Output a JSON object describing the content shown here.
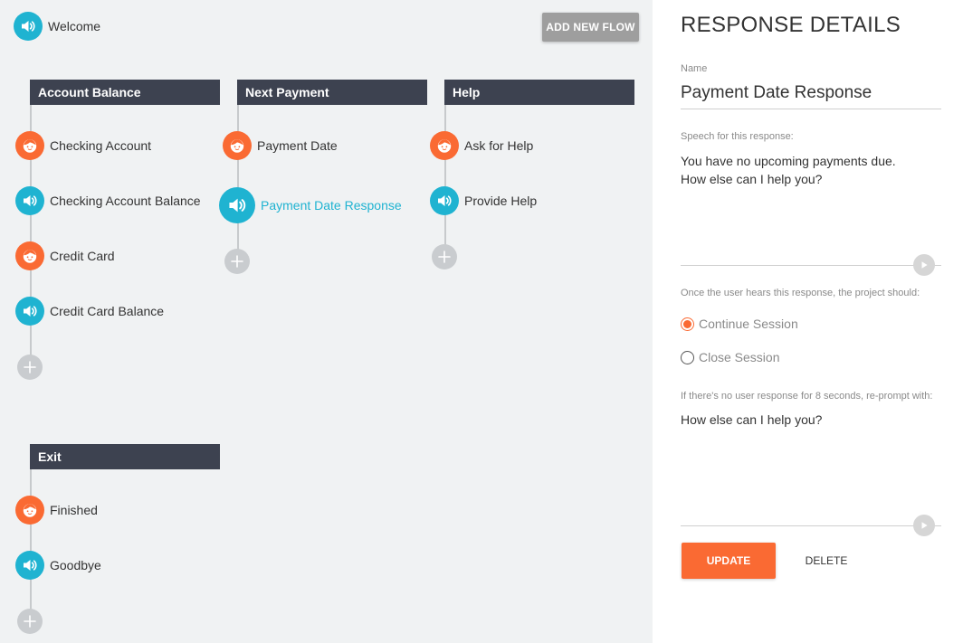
{
  "colors": {
    "accent_teal": "#1fb3d1",
    "accent_orange": "#fa6a33",
    "header_dark": "#3d4250",
    "canvas_bg": "#f0f2f3"
  },
  "welcome": {
    "label": "Welcome",
    "icon": "speaker-icon"
  },
  "toolbar": {
    "add_flow_label": "ADD NEW FLOW"
  },
  "flows": [
    {
      "title": "Account Balance",
      "nodes": [
        {
          "label": "Checking Account",
          "type": "user-input",
          "icon": "face-icon"
        },
        {
          "label": "Checking Account Balance",
          "type": "response",
          "icon": "speaker-icon"
        },
        {
          "label": "Credit Card",
          "type": "user-input",
          "icon": "face-icon"
        },
        {
          "label": "Credit Card Balance",
          "type": "response",
          "icon": "speaker-icon"
        }
      ]
    },
    {
      "title": "Next Payment",
      "nodes": [
        {
          "label": "Payment Date",
          "type": "user-input",
          "icon": "face-icon"
        },
        {
          "label": "Payment Date Response",
          "type": "response",
          "icon": "speaker-icon",
          "selected": true
        }
      ]
    },
    {
      "title": "Help",
      "nodes": [
        {
          "label": "Ask for Help",
          "type": "user-input",
          "icon": "face-icon"
        },
        {
          "label": "Provide Help",
          "type": "response",
          "icon": "speaker-icon"
        }
      ]
    },
    {
      "title": "Exit",
      "nodes": [
        {
          "label": "Finished",
          "type": "user-input",
          "icon": "face-icon"
        },
        {
          "label": "Goodbye",
          "type": "response",
          "icon": "speaker-icon"
        }
      ]
    }
  ],
  "panel": {
    "title": "RESPONSE DETAILS",
    "name_label": "Name",
    "name_value": "Payment Date Response",
    "speech_label": "Speech for this response:",
    "speech_text": "You have no upcoming payments due.\nHow else can I help you?",
    "after_label": "Once the user hears this response, the project should:",
    "options": [
      {
        "label": "Continue Session",
        "checked": true
      },
      {
        "label": "Close Session",
        "checked": false
      }
    ],
    "reprompt_label": "If there's no user response for 8 seconds, re-prompt with:",
    "reprompt_text": "How else can I help you?",
    "update_label": "UPDATE",
    "delete_label": "DELETE"
  }
}
